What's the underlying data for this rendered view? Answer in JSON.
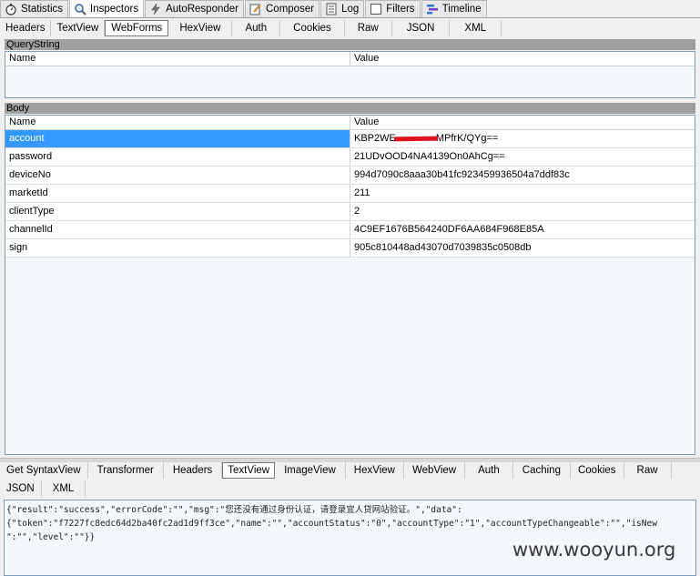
{
  "top_tabs": [
    {
      "label": "Statistics",
      "icon": "stopwatch-icon"
    },
    {
      "label": "Inspectors",
      "icon": "magnifier-icon"
    },
    {
      "label": "AutoResponder",
      "icon": "lightning-icon"
    },
    {
      "label": "Composer",
      "icon": "pencil-icon"
    },
    {
      "label": "Log",
      "icon": "document-icon"
    },
    {
      "label": "Filters",
      "icon": "checkbox-icon"
    },
    {
      "label": "Timeline",
      "icon": "timeline-icon"
    }
  ],
  "request_tabs": [
    "Headers",
    "TextView",
    "WebForms",
    "HexView",
    "Auth",
    "Cookies",
    "Raw",
    "JSON",
    "XML"
  ],
  "querystring": {
    "title": "QueryString",
    "col_name": "Name",
    "col_value": "Value"
  },
  "body": {
    "title": "Body",
    "col_name": "Name",
    "col_value": "Value",
    "rows": [
      {
        "name": "account",
        "value_start": "KBP2WE",
        "value_end": "MPfrK/QYg=="
      },
      {
        "name": "password",
        "value": "21UDvOOD4NA4139On0AhCg=="
      },
      {
        "name": "deviceNo",
        "value": "994d7090c8aaa30b41fc923459936504a7ddf83c"
      },
      {
        "name": "marketId",
        "value": "211"
      },
      {
        "name": "clientType",
        "value": "2"
      },
      {
        "name": "channelId",
        "value": "4C9EF1676B564240DF6AA684F968E85A"
      },
      {
        "name": "sign",
        "value": "905c810448ad43070d7039835c0508db"
      }
    ]
  },
  "response_tabs_row1": [
    "Get SyntaxView",
    "Transformer",
    "Headers",
    "TextView",
    "ImageView",
    "HexView",
    "WebView",
    "Auth",
    "Caching",
    "Cookies",
    "Raw"
  ],
  "response_tabs_row2": [
    "JSON",
    "XML"
  ],
  "response_text": {
    "line1": "{\"result\":\"success\",\"errorCode\":\"\",\"msg\":\"您还没有通过身份认证，请登录宜人贷网站验证。\",\"data\":",
    "line2": "{\"token\":\"f7227fc8edc64d2ba40fc2ad1d9ff3ce\",\"name\":\"\",\"accountStatus\":\"0\",\"accountType\":\"1\",\"accountTypeChangeable\":\"\",\"isNew",
    "line3": "\":\"\",\"level\":\"\"}}"
  },
  "watermark": "www.wooyun.org",
  "colors": {
    "selected_row": "#3399ff",
    "redaction": "#e0141e",
    "grid_border": "#7f9db9"
  }
}
